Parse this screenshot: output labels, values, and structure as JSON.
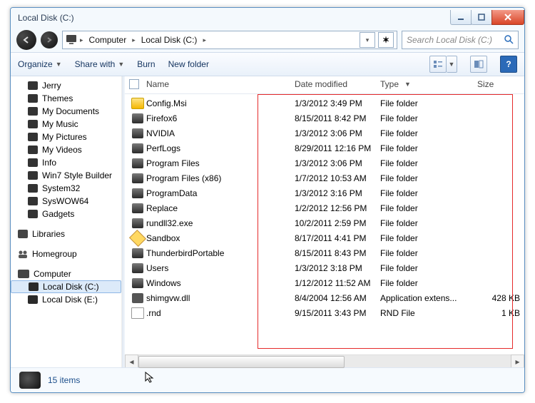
{
  "window": {
    "title": "Local Disk (C:)"
  },
  "breadcrumb": {
    "segments": [
      "Computer",
      "Local Disk (C:)"
    ]
  },
  "search": {
    "placeholder": "Search Local Disk (C:)"
  },
  "toolbar": {
    "organize": "Organize",
    "share": "Share with",
    "burn": "Burn",
    "newfolder": "New folder"
  },
  "sidebar": {
    "items": [
      "Jerry",
      "Themes",
      "My Documents",
      "My Music",
      "My Pictures",
      "My Videos",
      "Info",
      "Win7 Style Builder",
      "System32",
      "SysWOW64",
      "Gadgets"
    ],
    "roots": {
      "libraries": "Libraries",
      "homegroup": "Homegroup",
      "computer": "Computer"
    },
    "drives": [
      "Local Disk (C:)",
      "Local Disk (E:)"
    ]
  },
  "columns": {
    "name": "Name",
    "date": "Date modified",
    "type": "Type",
    "size": "Size"
  },
  "files": [
    {
      "icon": "msi",
      "name": "Config.Msi",
      "date": "1/3/2012 3:49 PM",
      "type": "File folder",
      "size": ""
    },
    {
      "icon": "folder",
      "name": "Firefox6",
      "date": "8/15/2011 8:42 PM",
      "type": "File folder",
      "size": ""
    },
    {
      "icon": "folder",
      "name": "NVIDIA",
      "date": "1/3/2012 3:06 PM",
      "type": "File folder",
      "size": ""
    },
    {
      "icon": "folder",
      "name": "PerfLogs",
      "date": "8/29/2011 12:16 PM",
      "type": "File folder",
      "size": ""
    },
    {
      "icon": "folder",
      "name": "Program Files",
      "date": "1/3/2012 3:06 PM",
      "type": "File folder",
      "size": ""
    },
    {
      "icon": "folder",
      "name": "Program Files (x86)",
      "date": "1/7/2012 10:53 AM",
      "type": "File folder",
      "size": ""
    },
    {
      "icon": "folder",
      "name": "ProgramData",
      "date": "1/3/2012 3:16 PM",
      "type": "File folder",
      "size": ""
    },
    {
      "icon": "folder",
      "name": "Replace",
      "date": "1/2/2012 12:56 PM",
      "type": "File folder",
      "size": ""
    },
    {
      "icon": "folder",
      "name": "rundll32.exe",
      "date": "10/2/2011 2:59 PM",
      "type": "File folder",
      "size": ""
    },
    {
      "icon": "sand",
      "name": "Sandbox",
      "date": "8/17/2011 4:41 PM",
      "type": "File folder",
      "size": ""
    },
    {
      "icon": "folder",
      "name": "ThunderbirdPortable",
      "date": "8/15/2011 8:43 PM",
      "type": "File folder",
      "size": ""
    },
    {
      "icon": "folder",
      "name": "Users",
      "date": "1/3/2012 3:18 PM",
      "type": "File folder",
      "size": ""
    },
    {
      "icon": "folder",
      "name": "Windows",
      "date": "1/12/2012 11:52 AM",
      "type": "File folder",
      "size": ""
    },
    {
      "icon": "dll",
      "name": "shimgvw.dll",
      "date": "8/4/2004 12:56 AM",
      "type": "Application extens...",
      "size": "428 KB"
    },
    {
      "icon": "file",
      "name": ".rnd",
      "date": "9/15/2011 3:43 PM",
      "type": "RND File",
      "size": "1 KB"
    }
  ],
  "status": {
    "count": "15 items"
  }
}
